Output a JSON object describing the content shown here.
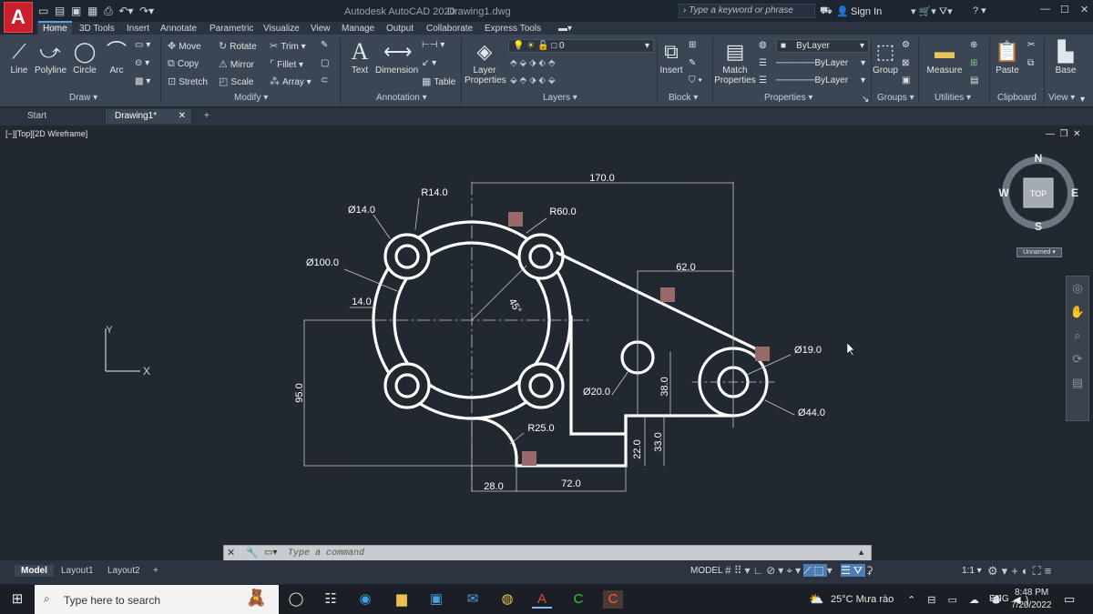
{
  "title_bar": {
    "app_logo": "A",
    "title": "Autodesk AutoCAD 2020",
    "document": "Drawing1.dwg",
    "search_placeholder": "Type a keyword or phrase",
    "sign_in": "Sign In",
    "window_minimize": "—",
    "window_maximize": "☐",
    "window_close": "✕"
  },
  "ribbon_tabs": [
    "Home",
    "3D Tools",
    "Insert",
    "Annotate",
    "Parametric",
    "Visualize",
    "View",
    "Manage",
    "Output",
    "Collaborate",
    "Express Tools"
  ],
  "ribbon": {
    "draw": {
      "line": "Line",
      "polyline": "Polyline",
      "circle": "Circle",
      "arc": "Arc",
      "title": "Draw ▾"
    },
    "modify": {
      "move": "Move",
      "rotate": "Rotate",
      "trim": "Trim",
      "copy": "Copy",
      "mirror": "Mirror",
      "fillet": "Fillet",
      "stretch": "Stretch",
      "scale": "Scale",
      "array": "Array",
      "title": "Modify ▾"
    },
    "annotation": {
      "text": "Text",
      "dimension": "Dimension",
      "table": "Table",
      "title": "Annotation ▾"
    },
    "layers": {
      "layer_properties_1": "Layer",
      "layer_properties_2": "Properties",
      "current_layer": "0",
      "title": "Layers ▾"
    },
    "block": {
      "insert": "Insert",
      "title": "Block ▾"
    },
    "properties": {
      "match_1": "Match",
      "match_2": "Properties",
      "color": "ByLayer",
      "linetype": "ByLayer",
      "lineweight": "ByLayer",
      "title": "Properties ▾"
    },
    "groups": {
      "group": "Group",
      "title": "Groups ▾"
    },
    "utilities": {
      "measure": "Measure",
      "title": "Utilities ▾"
    },
    "clipboard": {
      "paste": "Paste",
      "title": "Clipboard"
    },
    "view": {
      "base": "Base",
      "title": "View ▾"
    }
  },
  "doc_tabs": {
    "start": "Start",
    "drawing": "Drawing1*",
    "close": "✕",
    "new": "+"
  },
  "viewport": {
    "label": "[−][Top][2D Wireframe]",
    "viewcube": {
      "n": "N",
      "s": "S",
      "e": "E",
      "w": "W",
      "top": "TOP",
      "wcs": "Unnamed"
    },
    "ucs": {
      "x": "X",
      "y": "Y"
    }
  },
  "drawing_labels": {
    "d170": "170.0",
    "r14": "R14.0",
    "d14": "Ø14.0",
    "r60": "R60.0",
    "d100": "Ø100.0",
    "l14": "14.0",
    "a45": "45°",
    "l62": "62.0",
    "d19": "Ø19.0",
    "d20": "Ø20.0",
    "l38": "38.0",
    "d44": "Ø44.0",
    "l95": "95.0",
    "r25": "R25.0",
    "l22": "22.0",
    "l33": "33.0",
    "l28": "28.0",
    "l72": "72.0"
  },
  "command_line": {
    "placeholder": "Type a command"
  },
  "model_tabs": {
    "model": "Model",
    "layout1": "Layout1",
    "layout2": "Layout2",
    "add": "+"
  },
  "status_bar": {
    "model": "MODEL",
    "scale": "1:1"
  },
  "taskbar": {
    "search_placeholder": "Type here to search",
    "weather": "25°C  Mưa rào",
    "lang": "ENG",
    "time": "8:48 PM",
    "date": "7/20/2022"
  },
  "colors": {
    "accent": "#5ba1e8",
    "ribbon_bg": "#3b4553",
    "viewport_bg": "#212830",
    "logo": "#c8202c"
  }
}
